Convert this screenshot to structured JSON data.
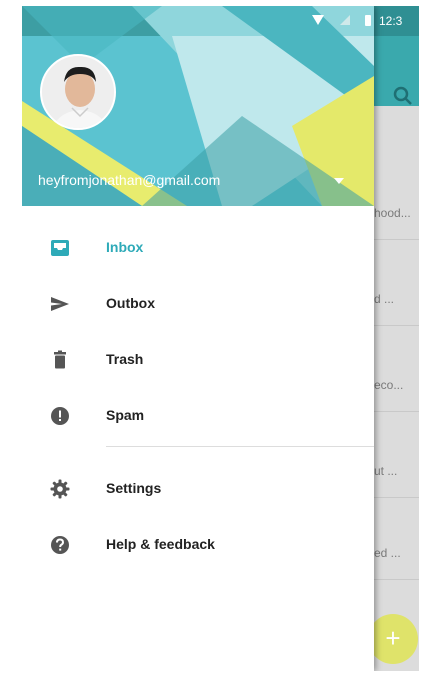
{
  "status_bar": {
    "time": "12:3"
  },
  "account": {
    "email": "heyfromjonathan@gmail.com"
  },
  "menu": {
    "items": [
      {
        "label": "Inbox",
        "icon": "inbox-icon",
        "active": true
      },
      {
        "label": "Outbox",
        "icon": "send-icon",
        "active": false
      },
      {
        "label": "Trash",
        "icon": "trash-icon",
        "active": false
      },
      {
        "label": "Spam",
        "icon": "spam-icon",
        "active": false
      }
    ],
    "secondary": [
      {
        "label": "Settings",
        "icon": "gear-icon"
      },
      {
        "label": "Help & feedback",
        "icon": "help-icon"
      }
    ]
  },
  "background_list": {
    "previews": [
      "hood...",
      "d ...",
      "eco...",
      "ut ...",
      "ed ..."
    ]
  },
  "fab": {
    "label": "+"
  },
  "colors": {
    "accent": "#2eaab8",
    "toolbar": "#3aa9ad",
    "header": "#5bc3d0",
    "fab": "#dfe36a"
  }
}
